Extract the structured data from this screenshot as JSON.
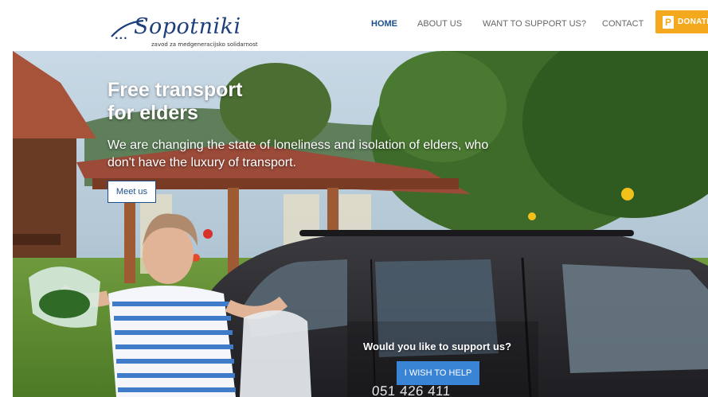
{
  "header": {
    "logo_text": "Sopotniki",
    "logo_dots": "...",
    "tagline": "zavod za medgeneracijsko solidarnost",
    "nav": {
      "home": "HOME",
      "about": "ABOUT US",
      "support": "WANT TO SUPPORT US?",
      "contact": "CONTACT"
    },
    "donate_label": "DONATE",
    "donate_icon": "P"
  },
  "hero": {
    "title_line1": "Free transport",
    "title_line2": "for elders",
    "subtitle": "We are changing the state of loneliness and isolation of elders, who don't have the luxury of transport.",
    "meet_button": "Meet us",
    "support_question": "Would you like to support us?",
    "help_button": "I WISH TO HELP",
    "car_number": "051 426 411"
  },
  "colors": {
    "brand_blue": "#1b4f8c",
    "donate_orange": "#f4a81d",
    "help_button": "#3a84d6"
  }
}
